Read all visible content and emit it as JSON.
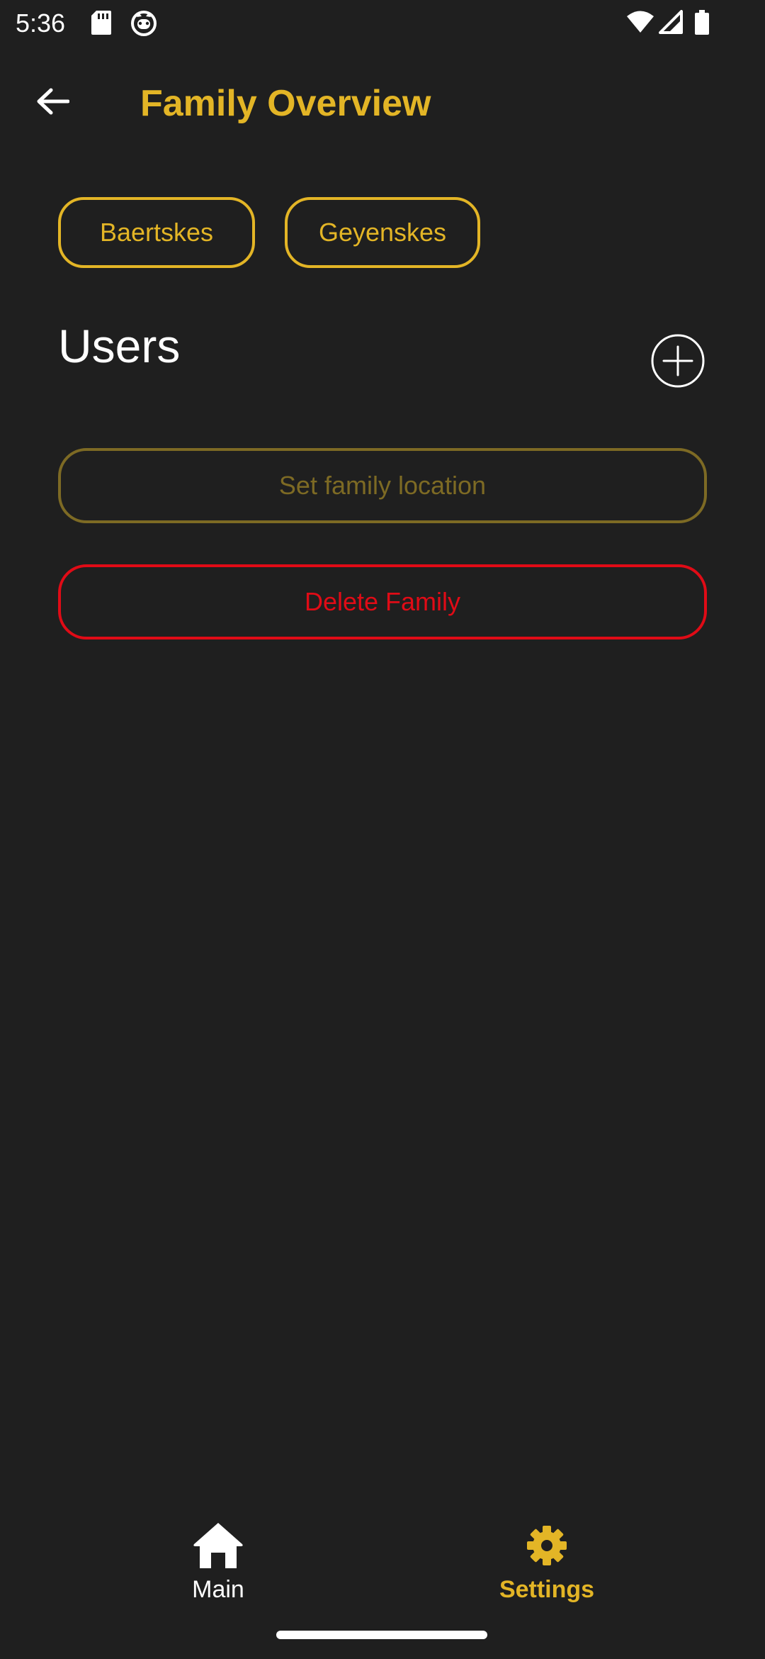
{
  "status_bar": {
    "time": "5:36",
    "icons_left": [
      "sd-card-icon",
      "cat-face-icon"
    ],
    "icons_right": [
      "wifi-icon",
      "cell-signal-icon",
      "battery-icon"
    ]
  },
  "app_bar": {
    "title": "Family Overview",
    "back_icon": "arrow-left-icon"
  },
  "families": [
    {
      "label": "Baertskes"
    },
    {
      "label": "Geyenskes"
    }
  ],
  "users": {
    "heading": "Users",
    "add_icon": "plus-circle-icon"
  },
  "actions": {
    "set_location_label": "Set family location",
    "delete_label": "Delete Family"
  },
  "bottom_nav": {
    "items": [
      {
        "label": "Main",
        "icon": "home-icon",
        "active": false
      },
      {
        "label": "Settings",
        "icon": "gear-icon",
        "active": true
      }
    ]
  },
  "colors": {
    "background": "#1f1f1f",
    "accent": "#e3b526",
    "accent_muted": "#7d6a24",
    "danger": "#e00b16",
    "text": "#ffffff"
  }
}
